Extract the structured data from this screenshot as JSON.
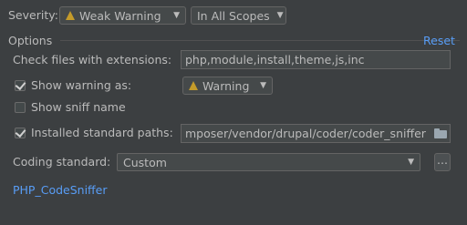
{
  "severity": {
    "label": "Severity:",
    "value": "Weak Warning",
    "value_icon": "warning-icon",
    "scope": "In All Scopes"
  },
  "options": {
    "title": "Options",
    "reset_label": "Reset"
  },
  "extensions": {
    "label": "Check files with extensions:",
    "value": "php,module,install,theme,js,inc"
  },
  "show_warning": {
    "label": "Show warning as:",
    "checked": true,
    "value": "Warning",
    "value_icon": "warning-icon"
  },
  "show_sniff": {
    "label": "Show sniff name",
    "checked": false
  },
  "installed_paths": {
    "label": "Installed standard paths:",
    "checked": true,
    "value": "mposer/vendor/drupal/coder/coder_sniffer",
    "browse_icon": "folder-icon"
  },
  "coding_standard": {
    "label": "Coding standard:",
    "value": "Custom",
    "more_label": "..."
  },
  "link": {
    "label": "PHP_CodeSniffer"
  },
  "colors": {
    "background": "#3c3f41",
    "text": "#bbbbbb",
    "link": "#589df6",
    "warning": "#c49b2a"
  }
}
